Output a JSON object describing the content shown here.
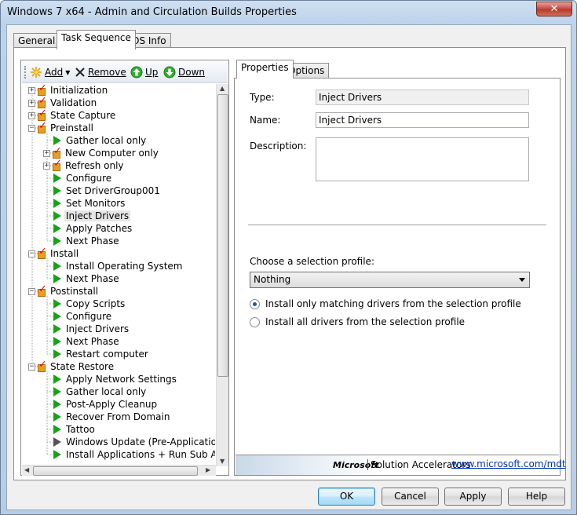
{
  "window": {
    "title": "Windows 7 x64 - Admin and Circulation Builds Properties",
    "close_label": "✕"
  },
  "tabs": [
    {
      "label": "General"
    },
    {
      "label": "Task Sequence"
    },
    {
      "label": "OS Info"
    }
  ],
  "toolbar": {
    "add": "Add",
    "remove": "Remove",
    "up": "Up",
    "down": "Down"
  },
  "tree": [
    {
      "label": "Initialization",
      "level": 0,
      "kind": "group",
      "expander": "+"
    },
    {
      "label": "Validation",
      "level": 0,
      "kind": "group",
      "expander": "+"
    },
    {
      "label": "State Capture",
      "level": 0,
      "kind": "group",
      "expander": "+"
    },
    {
      "label": "Preinstall",
      "level": 0,
      "kind": "group",
      "expander": "−"
    },
    {
      "label": "Gather local only",
      "level": 1,
      "kind": "step"
    },
    {
      "label": "New Computer only",
      "level": 1,
      "kind": "group",
      "expander": "+"
    },
    {
      "label": "Refresh only",
      "level": 1,
      "kind": "group",
      "expander": "+"
    },
    {
      "label": "Configure",
      "level": 1,
      "kind": "step"
    },
    {
      "label": "Set DriverGroup001",
      "level": 1,
      "kind": "step"
    },
    {
      "label": "Set Monitors",
      "level": 1,
      "kind": "step"
    },
    {
      "label": "Inject Drivers",
      "level": 1,
      "kind": "step",
      "selected": true
    },
    {
      "label": "Apply Patches",
      "level": 1,
      "kind": "step"
    },
    {
      "label": "Next Phase",
      "level": 1,
      "kind": "step"
    },
    {
      "label": "Install",
      "level": 0,
      "kind": "group",
      "expander": "−"
    },
    {
      "label": "Install Operating System",
      "level": 1,
      "kind": "step"
    },
    {
      "label": "Next Phase",
      "level": 1,
      "kind": "step"
    },
    {
      "label": "Postinstall",
      "level": 0,
      "kind": "group",
      "expander": "−"
    },
    {
      "label": "Copy Scripts",
      "level": 1,
      "kind": "step"
    },
    {
      "label": "Configure",
      "level": 1,
      "kind": "step"
    },
    {
      "label": "Inject Drivers",
      "level": 1,
      "kind": "step"
    },
    {
      "label": "Next Phase",
      "level": 1,
      "kind": "step"
    },
    {
      "label": "Restart computer",
      "level": 1,
      "kind": "step"
    },
    {
      "label": "State Restore",
      "level": 0,
      "kind": "group",
      "expander": "−"
    },
    {
      "label": "Apply Network Settings",
      "level": 1,
      "kind": "step"
    },
    {
      "label": "Gather local only",
      "level": 1,
      "kind": "step"
    },
    {
      "label": "Post-Apply Cleanup",
      "level": 1,
      "kind": "step"
    },
    {
      "label": "Recover From Domain",
      "level": 1,
      "kind": "step"
    },
    {
      "label": "Tattoo",
      "level": 1,
      "kind": "step"
    },
    {
      "label": "Windows Update (Pre-Application Inst",
      "level": 1,
      "kind": "step",
      "disabled": true
    },
    {
      "label": "Install Applications + Run Sub Applica",
      "level": 1,
      "kind": "step"
    }
  ],
  "subtabs": [
    {
      "label": "Properties"
    },
    {
      "label": "Options"
    }
  ],
  "properties": {
    "type_label": "Type:",
    "type_value": "Inject Drivers",
    "name_label": "Name:",
    "name_value": "Inject Drivers",
    "description_label": "Description:",
    "description_value": "",
    "profile_label": "Choose a selection profile:",
    "profile_value": "Nothing",
    "radio1": "Install only matching drivers from the selection profile",
    "radio2": "Install all drivers from the selection profile",
    "radio_selected": 1
  },
  "banner": {
    "brand": "Microsoft",
    "product": "Solution Accelerators",
    "link": "www.microsoft.com/mdt"
  },
  "buttons": {
    "ok": "OK",
    "cancel": "Cancel",
    "apply": "Apply",
    "help": "Help"
  },
  "colors": {
    "step_icon": "#16a316",
    "disabled_step_icon": "#555555",
    "check": "#d01010"
  }
}
